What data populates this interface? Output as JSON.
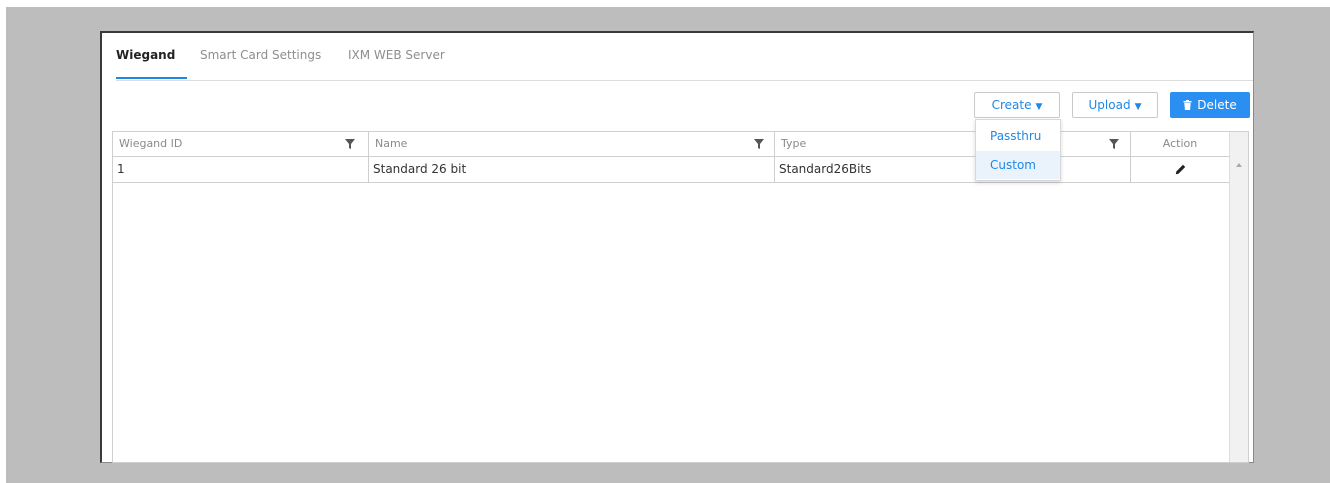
{
  "tabs": [
    {
      "label": "Wiegand",
      "active": true
    },
    {
      "label": "Smart Card Settings",
      "active": false
    },
    {
      "label": "IXM WEB Server",
      "active": false
    }
  ],
  "toolbar": {
    "create_label": "Create",
    "upload_label": "Upload",
    "delete_label": "Delete",
    "caret_icon": "caret-down-icon",
    "delete_icon": "trash-icon",
    "accent_color": "#1e88e5"
  },
  "create_menu": {
    "items": [
      {
        "label": "Passthru"
      },
      {
        "label": "Custom",
        "highlighted": true
      }
    ]
  },
  "grid": {
    "columns": [
      {
        "label": "Wiegand ID",
        "filter": true
      },
      {
        "label": "Name",
        "filter": true
      },
      {
        "label": "Type",
        "filter": true
      },
      {
        "label": "Action",
        "filter": false
      }
    ],
    "rows": [
      {
        "wiegand_id": "1",
        "name": "Standard 26 bit",
        "type": "Standard26Bits",
        "action_icon": "pencil-icon"
      }
    ]
  }
}
